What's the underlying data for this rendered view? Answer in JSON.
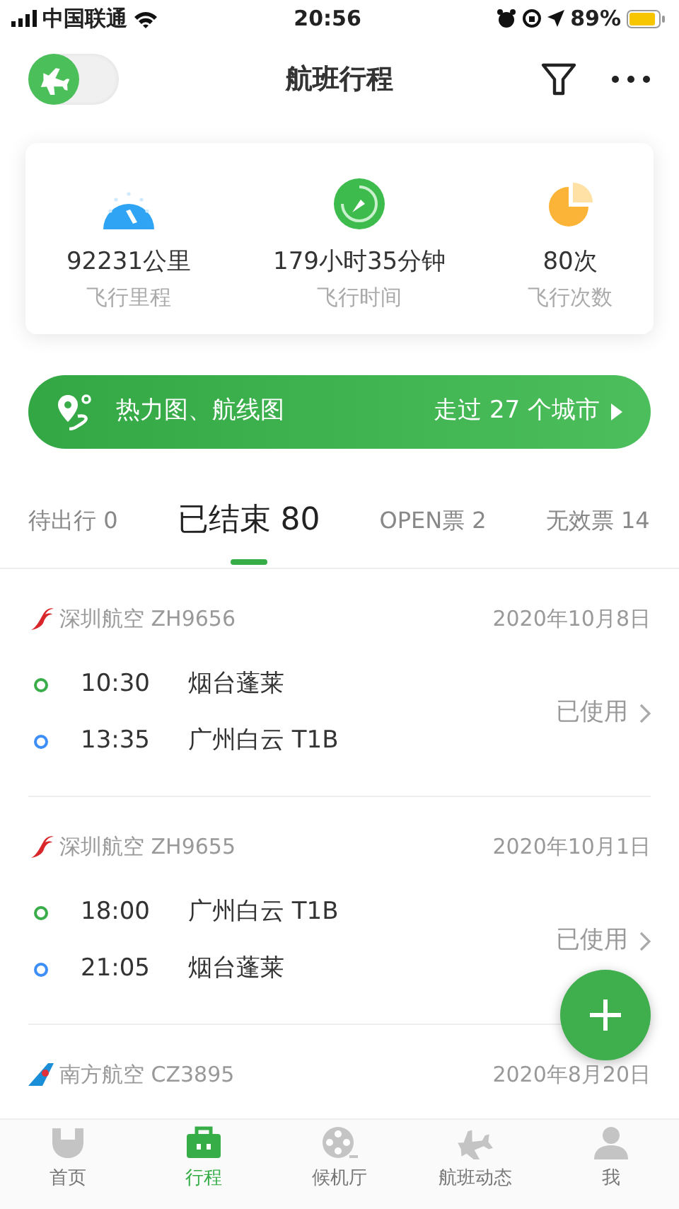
{
  "status_bar": {
    "carrier": "中国联通",
    "time": "20:56",
    "battery": "89%"
  },
  "header": {
    "title": "航班行程",
    "mode_toggle": {
      "on": false
    }
  },
  "stats": [
    {
      "kind": "distance",
      "value": "92231公里",
      "label": "飞行里程"
    },
    {
      "kind": "time",
      "value": "179小时35分钟",
      "label": "飞行时间"
    },
    {
      "kind": "count",
      "value": "80次",
      "label": "飞行次数"
    }
  ],
  "banner": {
    "title": "热力图、航线图",
    "link": "走过 27 个城市"
  },
  "tabs": [
    {
      "label": "待出行 0",
      "selected": false
    },
    {
      "label": "已结束 80",
      "selected": true
    },
    {
      "label": "OPEN票 2",
      "selected": false
    },
    {
      "label": "无效票 14",
      "selected": false
    }
  ],
  "flights": [
    {
      "airline": "深圳航空 ZH9656",
      "date": "2020年10月8日",
      "status": "已使用",
      "segments": [
        {
          "time": "10:30",
          "place": "烟台蓬莱"
        },
        {
          "time": "13:35",
          "place": "广州白云 T1B"
        }
      ]
    },
    {
      "airline": "深圳航空 ZH9655",
      "date": "2020年10月1日",
      "status": "已使用",
      "segments": [
        {
          "time": "18:00",
          "place": "广州白云 T1B"
        },
        {
          "time": "21:05",
          "place": "烟台蓬莱"
        }
      ]
    },
    {
      "airline": "南方航空 CZ3895",
      "date": "2020年8月20日"
    }
  ],
  "bottom_nav": [
    {
      "label": "首页",
      "selected": false
    },
    {
      "label": "行程",
      "selected": true
    },
    {
      "label": "候机厅",
      "selected": false
    },
    {
      "label": "航班动态",
      "selected": false
    },
    {
      "label": "我",
      "selected": false
    }
  ]
}
